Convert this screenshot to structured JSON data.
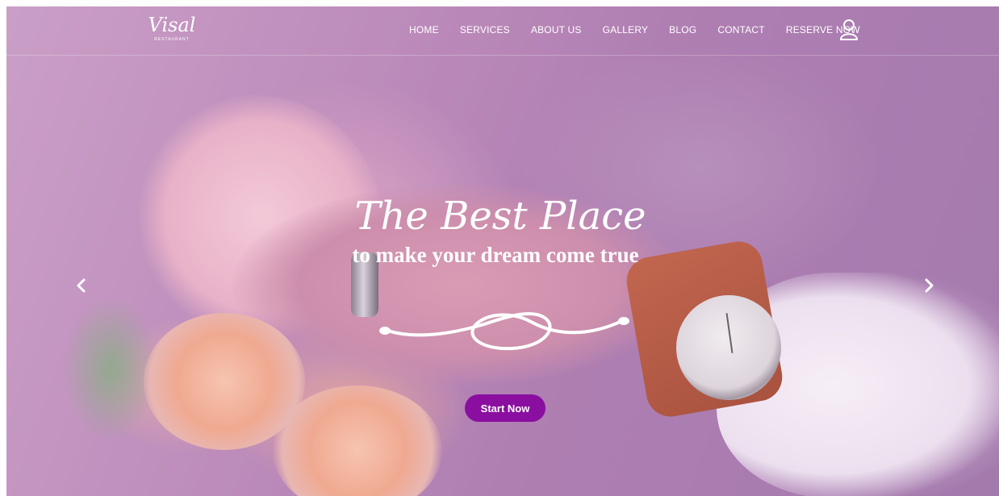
{
  "header": {
    "logo_text": "Visal",
    "logo_subtext": "RESTAURANT",
    "nav": {
      "items": [
        {
          "label": "HOME"
        },
        {
          "label": "SERVICES"
        },
        {
          "label": "ABOUT US"
        },
        {
          "label": "GALLERY"
        },
        {
          "label": "BLOG"
        },
        {
          "label": "CONTACT"
        },
        {
          "label": "RESERVE NOW"
        }
      ]
    },
    "user_icon": "user-icon"
  },
  "hero": {
    "headline": "The Best Place",
    "subline": "to make your dream come true",
    "cta_label": "Start Now",
    "prev_icon": "chevron-left-icon",
    "next_icon": "chevron-right-icon",
    "flourish_icon": "heart-flourish-icon"
  },
  "colors": {
    "accent": "#8a0fa0",
    "overlay": "#b48ab8",
    "text": "#ffffff"
  }
}
